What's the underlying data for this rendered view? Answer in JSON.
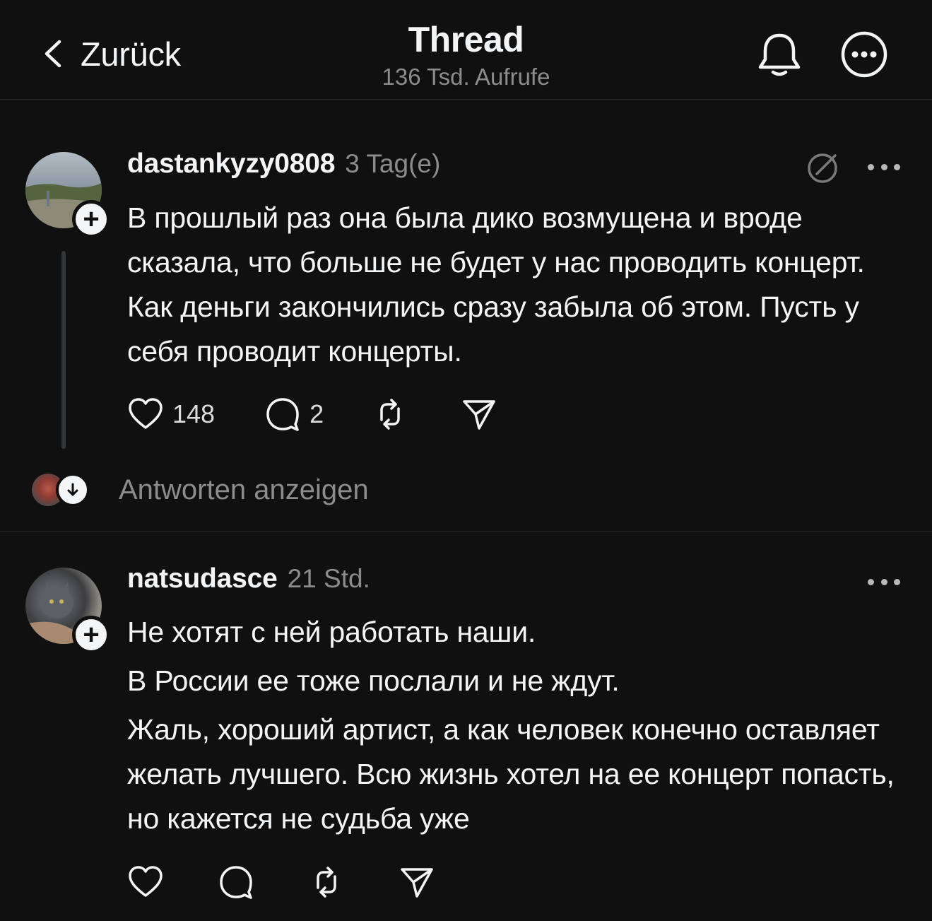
{
  "header": {
    "back_label": "Zurück",
    "title": "Thread",
    "views": "136 Tsd. Aufrufe",
    "icons": [
      "chevron-left-icon",
      "bell-icon",
      "more-circle-icon"
    ]
  },
  "posts": [
    {
      "username": "dastankyzy0808",
      "time": "3 Tag(e)",
      "paragraphs": [
        "В прошлый раз она была дико возмущена и вроде сказала, что больше не будет у нас проводить концерт.  Как деньги закончились сразу забыла об этом. Пусть у себя проводит концерты."
      ],
      "likes": "148",
      "replies": "2"
    },
    {
      "username": "natsudasce",
      "time": "21 Std.",
      "paragraphs": [
        "Не хотят с ней работать наши.",
        "В России ее тоже послали и не ждут.",
        "Жаль, хороший артист, а как человек конечно оставляет желать лучшего. Всю жизнь хотел на ее концерт попасть, но кажется не судьба уже"
      ]
    }
  ],
  "show_replies_label": "Antworten anzeigen",
  "colors": {
    "background": "#101010",
    "text": "#f3f5f7",
    "muted": "#8c8c8c"
  }
}
